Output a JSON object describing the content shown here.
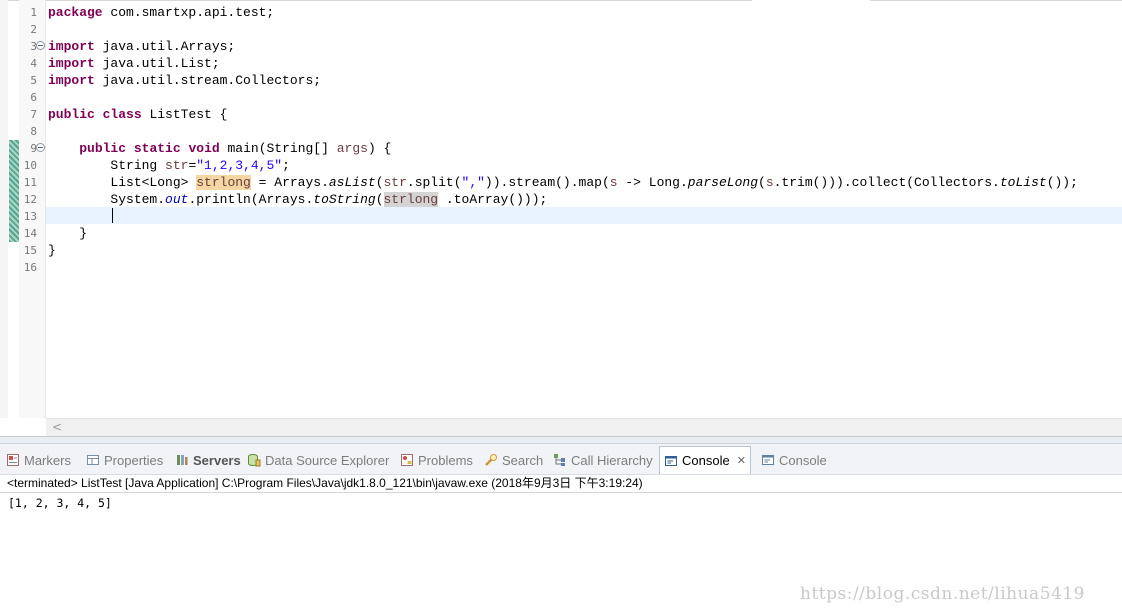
{
  "editor": {
    "line_numbers": [
      "1",
      "2",
      "3",
      "4",
      "5",
      "6",
      "7",
      "8",
      "9",
      "10",
      "11",
      "12",
      "13",
      "14",
      "15",
      "16"
    ],
    "code": {
      "l1_kw": "package",
      "l1_rest": " com.smartxp.api.test;",
      "l3_kw": "import",
      "l3_rest": " java.util.Arrays;",
      "l4_kw": "import",
      "l4_rest": " java.util.List;",
      "l5_kw": "import",
      "l5_rest": " java.util.stream.Collectors;",
      "l7_kw1": "public",
      "l7_kw2": "class",
      "l7_rest": " ListTest {",
      "l9_indent": "    ",
      "l9_kw1": "public",
      "l9_kw2": "static",
      "l9_kw3": "void",
      "l9_rest": " main(String[] ",
      "l9_var": "args",
      "l9_end": ") {",
      "l10_indent": "        ",
      "l10_a": "String ",
      "l10_var": "str",
      "l10_eq": "=",
      "l10_str": "\"1,2,3,4,5\"",
      "l10_end": ";",
      "l11_indent": "        ",
      "l11_a": "List<Long> ",
      "l11_hl": "strlong",
      "l11_b": " = Arrays.",
      "l11_it1": "asList",
      "l11_c": "(",
      "l11_var1": "str",
      "l11_d": ".split(",
      "l11_str": "\",\"",
      "l11_e": ")).stream().map(",
      "l11_var2": "s",
      "l11_f": " -> Long.",
      "l11_it2": "parseLong",
      "l11_g": "(",
      "l11_var3": "s",
      "l11_h": ".trim())).collect(Collectors.",
      "l11_it3": "toList",
      "l11_i": "());",
      "l12_indent": "        ",
      "l12_a": "System.",
      "l12_fld": "out",
      "l12_b": ".println(Arrays.",
      "l12_it": "toString",
      "l12_c": "(",
      "l12_hl": "strlong",
      "l12_d": " .toArray()));",
      "l14_text": "    }",
      "l15_text": "}"
    },
    "scroll_left_arrow": "<"
  },
  "views": {
    "tabs": [
      {
        "label": "Markers",
        "icon": "markers-icon"
      },
      {
        "label": "Properties",
        "icon": "properties-icon"
      },
      {
        "label": "Servers",
        "icon": "servers-icon"
      },
      {
        "label": "Data Source Explorer",
        "icon": "data-source-explorer-icon"
      },
      {
        "label": "Problems",
        "icon": "problems-icon"
      },
      {
        "label": "Search",
        "icon": "search-icon"
      },
      {
        "label": "Call Hierarchy",
        "icon": "call-hierarchy-icon"
      },
      {
        "label": "Console",
        "icon": "console-icon",
        "active": true,
        "close": "✕"
      },
      {
        "label": "Console",
        "icon": "console-icon"
      }
    ],
    "console_status": "<terminated> ListTest [Java Application] C:\\Program Files\\Java\\jdk1.8.0_121\\bin\\javaw.exe (2018年9月3日 下午3:19:24)",
    "console_output": "[1, 2, 3, 4, 5]"
  },
  "watermark": "https://blog.csdn.net/lihua5419",
  "colors": {
    "keyword": "#7f0055",
    "string": "#2a00ff",
    "local_variable": "#6a3e3e",
    "static_field": "#0000c0",
    "write_occurrence": "#f5d7a4",
    "read_occurrence": "#d4d4d4",
    "current_line": "#e8f2fe"
  }
}
